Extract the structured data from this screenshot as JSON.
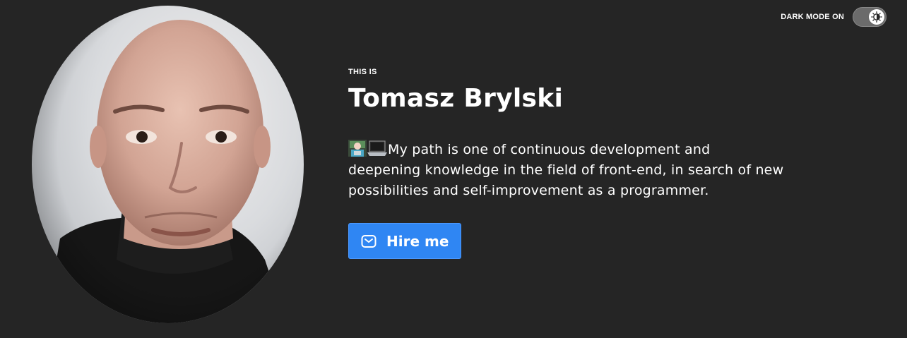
{
  "theme": {
    "label": "DARK MODE ON",
    "enabled": true,
    "toggle_icon": "brightness-half-icon"
  },
  "hero": {
    "eyebrow": "THIS IS",
    "name": "Tomasz Brylski",
    "bio_emojis": [
      "technologist-emoji",
      "laptop-emoji"
    ],
    "bio": "My path is one of continuous development and deepening knowledge in the field of front-end, in search of new possibilities and self-improvement as a programmer.",
    "cta_label": "Hire me",
    "cta_icon": "mail-icon"
  },
  "colors": {
    "background": "#252525",
    "accent": "#2f86f3",
    "text": "#ffffff"
  }
}
